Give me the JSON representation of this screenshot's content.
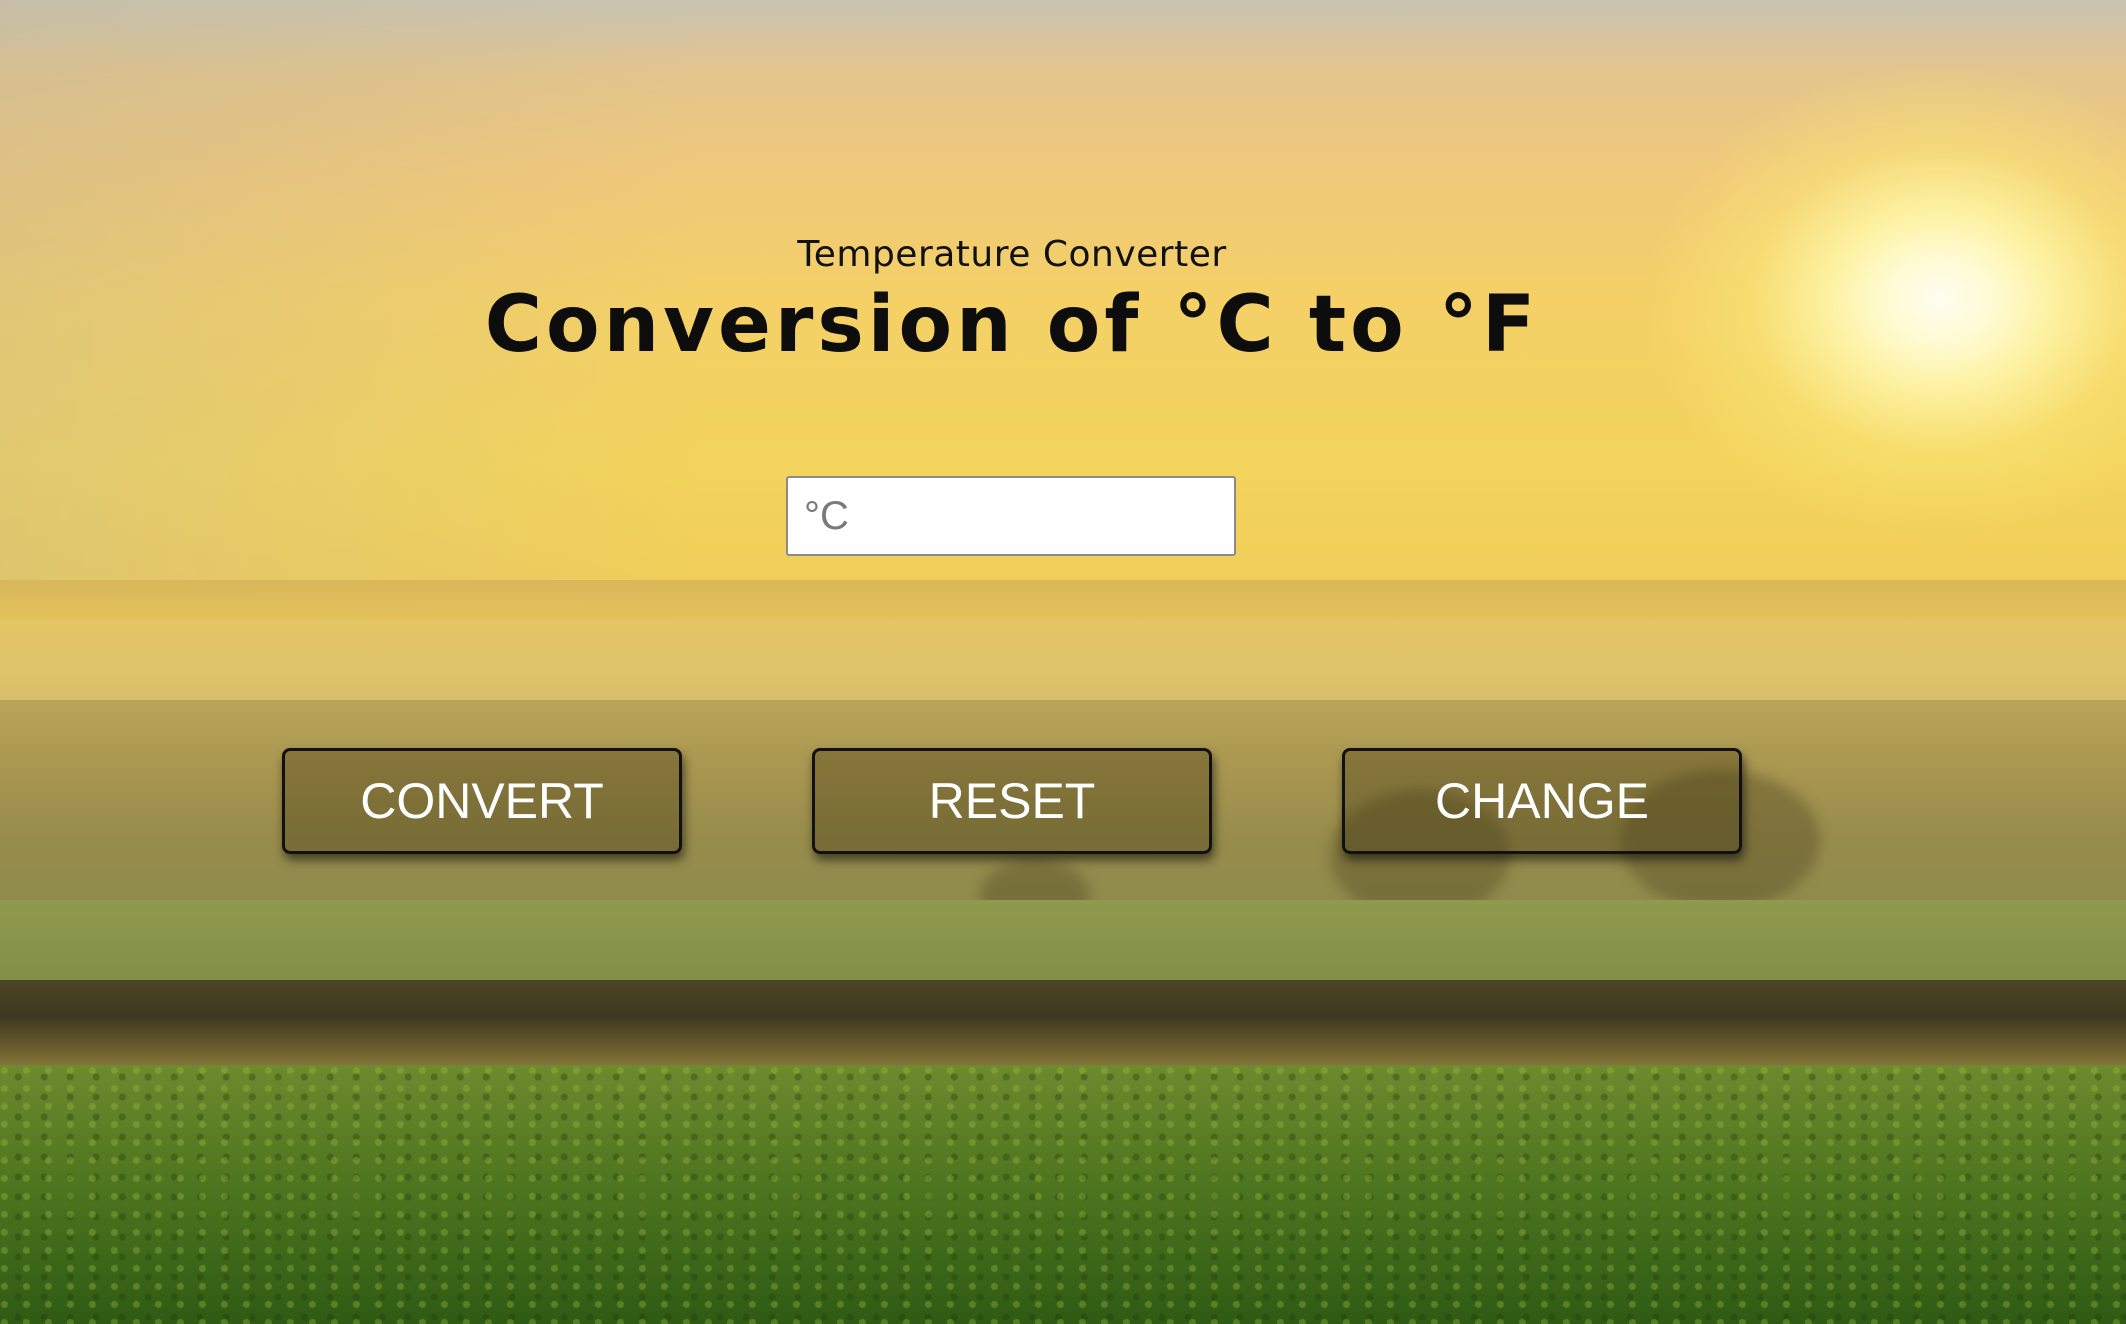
{
  "header": {
    "subtitle": "Temperature Converter",
    "title": "Conversion of °C to °F"
  },
  "input": {
    "placeholder": "°C",
    "value": ""
  },
  "buttons": {
    "convert_label": "CONVERT",
    "reset_label": "RESET",
    "change_label": "CHANGE"
  },
  "colors": {
    "text": "#111111",
    "button_text": "#ffffff",
    "button_border": "#111111"
  }
}
